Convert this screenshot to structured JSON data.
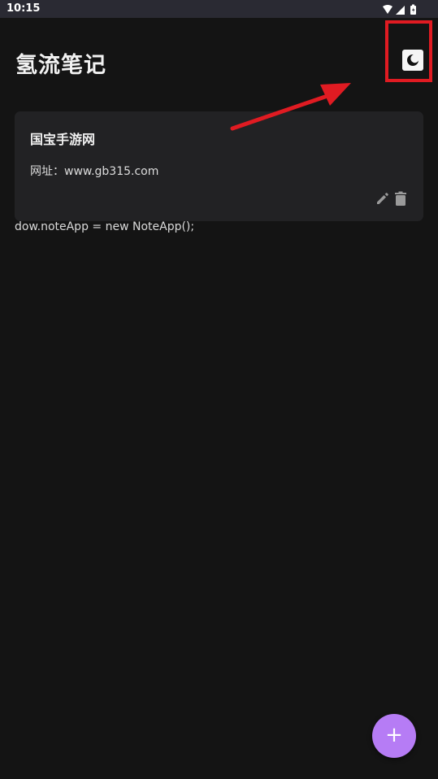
{
  "status_bar": {
    "time": "10:15",
    "icons": [
      "wifi-icon",
      "signal-icon",
      "battery-icon"
    ]
  },
  "header": {
    "title": "氢流笔记",
    "theme_toggle_icon": "moon-icon"
  },
  "notes": [
    {
      "title": "国宝手游网",
      "body": "网址：www.gb315.com",
      "actions": [
        "edit-icon",
        "delete-icon"
      ]
    }
  ],
  "stray_text": "dow.noteApp = new NoteApp();",
  "fab": {
    "label": "+",
    "icon": "add-icon"
  },
  "colors": {
    "background": "#141414",
    "card": "#222224",
    "fab": "#b67cf5",
    "annotation": "#e01b22"
  }
}
